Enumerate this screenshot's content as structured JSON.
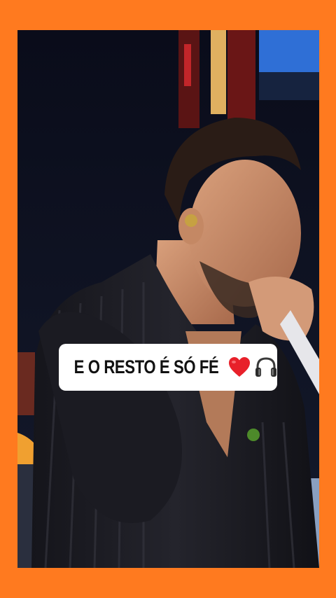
{
  "caption": {
    "text": "E O RESTO É SÓ FÉ",
    "icons": [
      "red-heart-icon",
      "headphones-icon"
    ]
  },
  "colors": {
    "frame": "#ff7a1f",
    "caption_background": "#ffffff",
    "caption_text": "#111111",
    "heart": "#e8202a"
  }
}
